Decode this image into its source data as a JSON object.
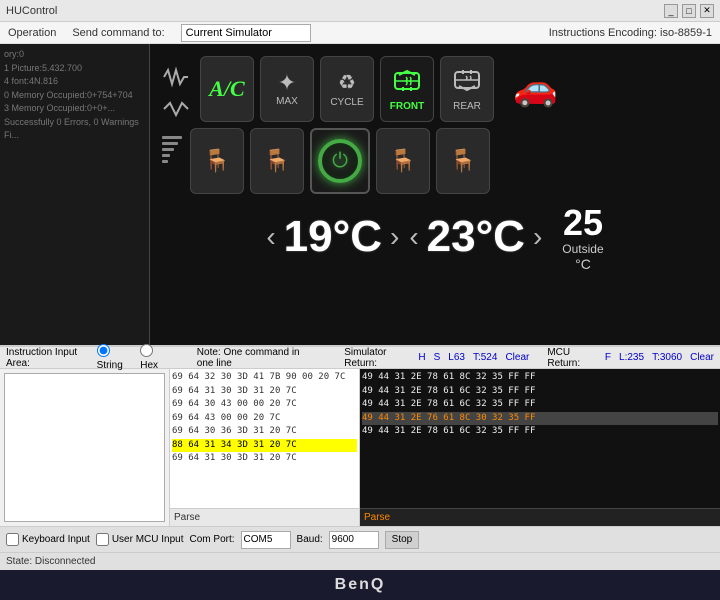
{
  "window": {
    "title": "HUControl",
    "encoding_label": "Instructions Encoding: iso-8859-1"
  },
  "menu": {
    "operation": "Operation",
    "send_command": "Send command to:",
    "simulator_name": "Current Simulator"
  },
  "controls": {
    "ac_label": "A/C",
    "max_label": "MAX",
    "cycle_label": "CYCLE",
    "front_label": "FRONT",
    "rear_label": "REAR",
    "temp_left": "19°C",
    "temp_right": "23°C",
    "outside_temp": "25",
    "outside_label": "Outside",
    "outside_unit": "°C"
  },
  "bottom": {
    "input_area_label": "Instruction Input Area:",
    "string_label": "String",
    "hex_label": "Hex",
    "note": "Note: One command in one line",
    "simulator_label": "Simulator Return:",
    "mcu_label": "MCU Return:",
    "h_label": "H",
    "s_label": "S",
    "l63_label": "L63",
    "t524_label": "T:524",
    "clear_label": "Clear",
    "f_label": "F",
    "l235_label": "L:235",
    "t3060_label": "T:3060",
    "clear2_label": "Clear",
    "parse_label": "Parse",
    "keyboard_label": "Keyboard Input",
    "user_mcu_label": "User MCU Input",
    "com_port_label": "Com Port:",
    "com_port_value": "COM5",
    "baud_label": "Baud:",
    "baud_value": "9600",
    "stop_label": "Stop",
    "status_label": "State: Disconnected"
  },
  "hex_rows": [
    {
      "text": "69 64 32 30 3D 41 7B 90 00 20 7C",
      "type": "normal"
    },
    {
      "text": "69 64 31 30 3D 31 20 7C",
      "type": "normal"
    },
    {
      "text": "69 64 30 43 00 00 20 7C",
      "type": "normal"
    },
    {
      "text": "69 64 43 00 00 20 7C",
      "type": "normal"
    },
    {
      "text": "69 64 30 36 3D 31 20 7C",
      "type": "normal"
    },
    {
      "text": "88 64 31 34 3D 31 20 7C",
      "type": "highlighted"
    },
    {
      "text": "69 64 31 30 3D 31 20 7C",
      "type": "normal"
    }
  ],
  "mcu_rows": [
    {
      "text": "49 44 31 2E 78 61 8C 32 35 FF FF",
      "type": "normal"
    },
    {
      "text": "49 44 31 2E 78 61 6C 32 35 FF FF",
      "type": "normal"
    },
    {
      "text": "49 44 31 2E 78 61 6C 32 35 FF FF",
      "type": "normal"
    },
    {
      "text": "49 44 31 2E 76 61 8C 30 32 35 FF",
      "type": "selected"
    },
    {
      "text": "49 44 31 2E 78 61 6C 32 35 FF FF",
      "type": "normal"
    }
  ],
  "log_lines": [
    "ory:0",
    "1 Picture:5.432.700",
    "4 font:4N.816",
    "0 Memory Occupied:0+754+704",
    "3 Memory Occupied:0+0+...",
    "Successfully 0 Errors, 0 Warnings Fi..."
  ],
  "taskbar": {
    "benq": "BenQ"
  }
}
